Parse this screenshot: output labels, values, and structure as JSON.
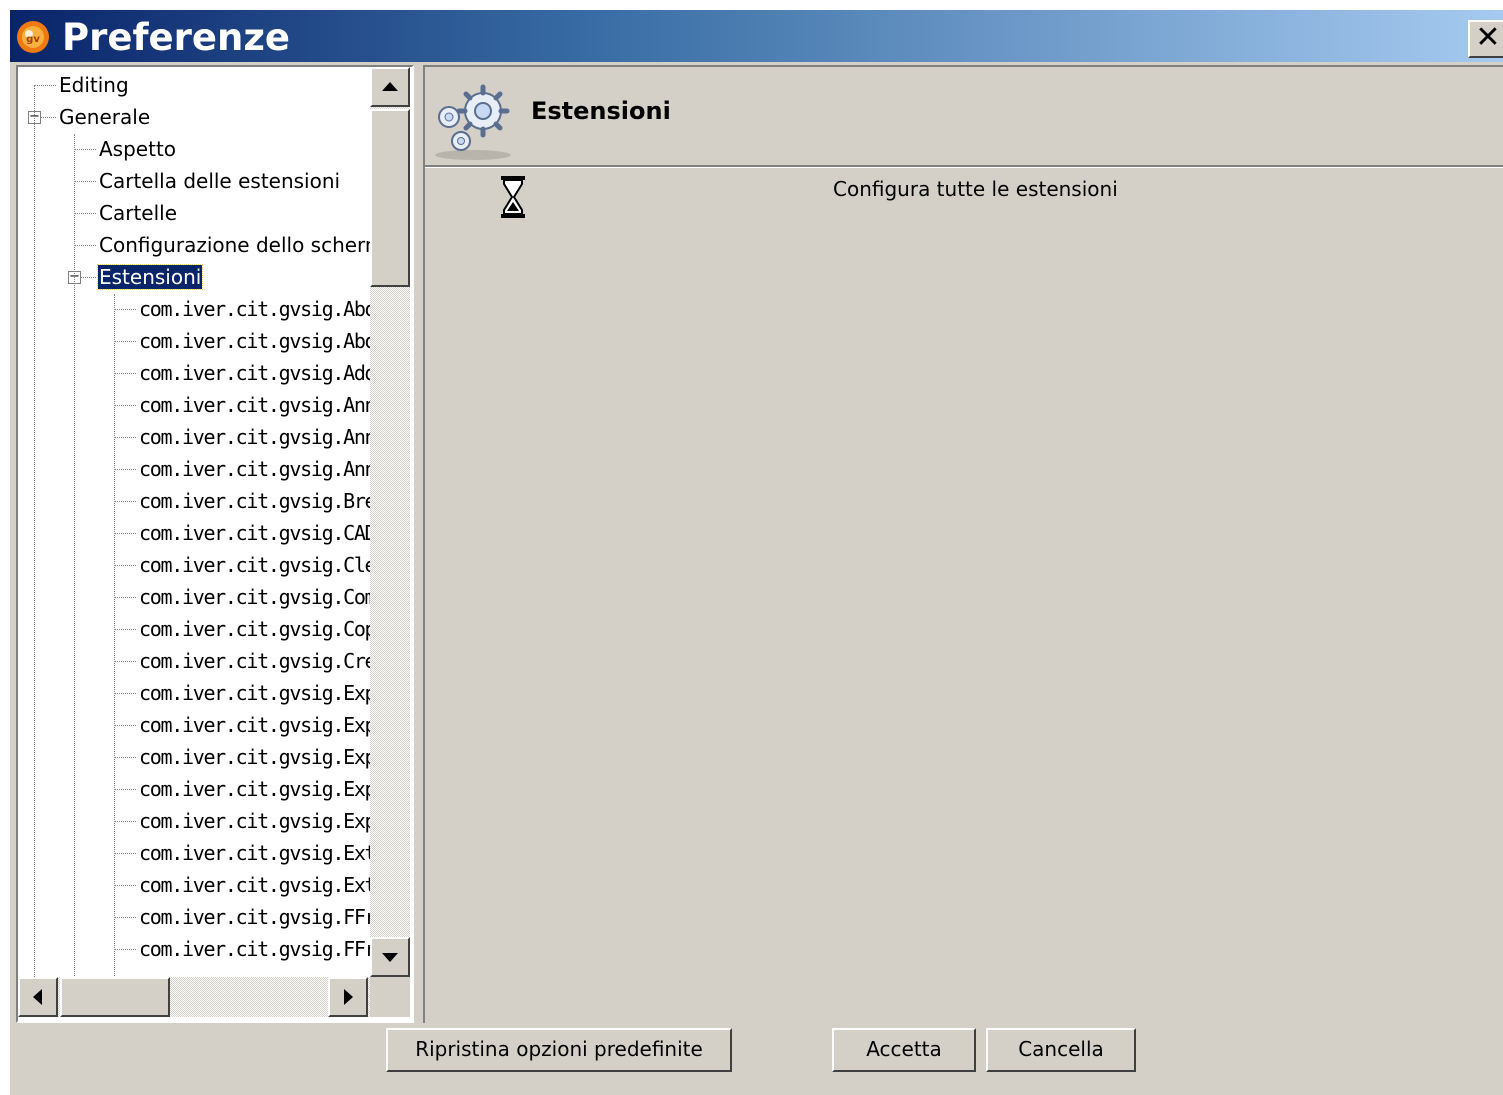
{
  "window": {
    "title": "Preferenze",
    "close_symbol": "✕",
    "app_icon": "gvsig-logo-icon"
  },
  "tree": {
    "nodes": [
      {
        "label": "Editing",
        "level": 0,
        "expander": null,
        "mono": false
      },
      {
        "label": "Generale",
        "level": 0,
        "expander": "minus",
        "mono": false
      },
      {
        "label": "Aspetto",
        "level": 1,
        "expander": null,
        "mono": false
      },
      {
        "label": "Cartella delle estensioni",
        "level": 1,
        "expander": null,
        "mono": false
      },
      {
        "label": "Cartelle",
        "level": 1,
        "expander": null,
        "mono": false
      },
      {
        "label": "Configurazione dello scherm",
        "level": 1,
        "expander": null,
        "mono": false
      },
      {
        "label": "Estensioni",
        "level": 1,
        "expander": "minus",
        "mono": false,
        "selected": true
      },
      {
        "label": "com.iver.cit.gvsig.Abou",
        "level": 2,
        "mono": true
      },
      {
        "label": "com.iver.cit.gvsig.Abou",
        "level": 2,
        "mono": true
      },
      {
        "label": "com.iver.cit.gvsig.AddL",
        "level": 2,
        "mono": true
      },
      {
        "label": "com.iver.cit.gvsig.Anno",
        "level": 2,
        "mono": true
      },
      {
        "label": "com.iver.cit.gvsig.Anno",
        "level": 2,
        "mono": true
      },
      {
        "label": "com.iver.cit.gvsig.Anno",
        "level": 2,
        "mono": true
      },
      {
        "label": "com.iver.cit.gvsig.Break",
        "level": 2,
        "mono": true
      },
      {
        "label": "com.iver.cit.gvsig.CADE",
        "level": 2,
        "mono": true
      },
      {
        "label": "com.iver.cit.gvsig.Clear",
        "level": 2,
        "mono": true
      },
      {
        "label": "com.iver.cit.gvsig.Comp",
        "level": 2,
        "mono": true
      },
      {
        "label": "com.iver.cit.gvsig.Copy",
        "level": 2,
        "mono": true
      },
      {
        "label": "com.iver.cit.gvsig.Creat",
        "level": 2,
        "mono": true
      },
      {
        "label": "com.iver.cit.gvsig.Explo",
        "level": 2,
        "mono": true
      },
      {
        "label": "com.iver.cit.gvsig.Expor",
        "level": 2,
        "mono": true
      },
      {
        "label": "com.iver.cit.gvsig.Expor",
        "level": 2,
        "mono": true
      },
      {
        "label": "com.iver.cit.gvsig.Expor",
        "level": 2,
        "mono": true
      },
      {
        "label": "com.iver.cit.gvsig.Expre",
        "level": 2,
        "mono": true
      },
      {
        "label": "com.iver.cit.gvsig.ExtDE",
        "level": 2,
        "mono": true
      },
      {
        "label": "com.iver.cit.gvsig.Exter",
        "level": 2,
        "mono": true
      },
      {
        "label": "com.iver.cit.gvsig.FFrar",
        "level": 2,
        "mono": true
      },
      {
        "label": "com.iver.cit.gvsig.FFrar",
        "level": 2,
        "mono": true
      }
    ],
    "scroll_up_icon": "arrow-up-icon",
    "scroll_down_icon": "arrow-down-icon",
    "scroll_left_icon": "arrow-left-icon",
    "scroll_right_icon": "arrow-right-icon"
  },
  "content": {
    "section_title": "Estensioni",
    "section_icon": "gears-icon",
    "row_icon": "hourglass-icon",
    "row_text": "Configura tutte le estensioni"
  },
  "buttons": {
    "reset": "Ripristina opzioni predefinite",
    "ok": "Accetta",
    "cancel": "Cancella"
  },
  "colors": {
    "titlebar_start": "#0a246a",
    "titlebar_end": "#a6caf0",
    "dialog_bg": "#d4d0c8",
    "selection_bg": "#0a246a"
  }
}
